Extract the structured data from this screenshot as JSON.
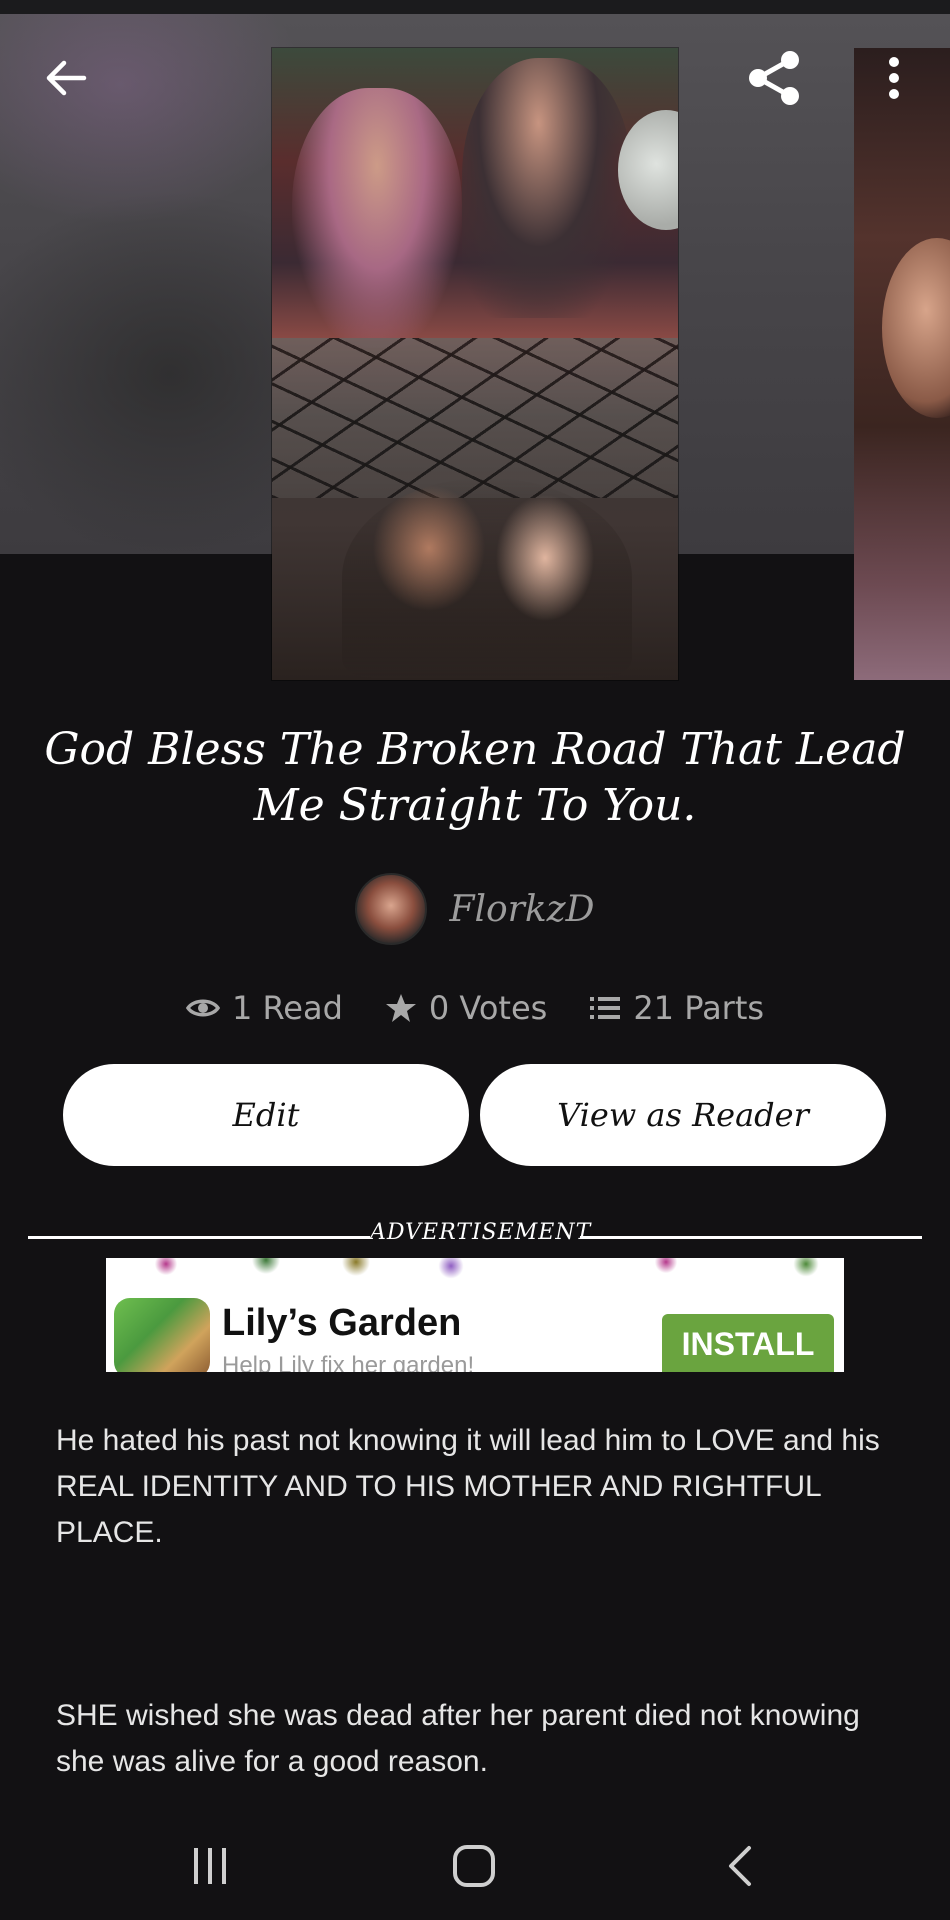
{
  "story": {
    "title": "God Bless The Broken Road That Lead Me Straight To You.",
    "author": "FlorkzD"
  },
  "stats": {
    "reads": "1 Read",
    "votes": "0 Votes",
    "parts": "21 Parts"
  },
  "actions": {
    "edit_label": "Edit",
    "view_as_reader_label": "View as Reader"
  },
  "advertisement": {
    "label": "ADVERTISEMENT",
    "app_name": "Lily’s Garden",
    "tagline": "Help Lily fix her garden!",
    "cta": "INSTALL",
    "cta_color": "#6aa43f"
  },
  "description": {
    "paragraph_1": "He hated his past not knowing it will lead him to LOVE and his REAL IDENTITY AND TO HIS MOTHER AND RIGHTFUL PLACE.",
    "paragraph_2": "SHE wished she was dead after her parent died not knowing she was alive for a good reason."
  },
  "icons": {
    "back": "back-arrow-icon",
    "share": "share-icon",
    "more": "more-vertical-icon",
    "reads": "eye-icon",
    "votes": "star-icon",
    "parts": "list-icon",
    "nav_recent": "recent-apps-icon",
    "nav_home": "home-icon",
    "nav_back": "chevron-left-icon"
  },
  "colors": {
    "background": "#121113",
    "stat_text": "#a8a8a8",
    "author_text": "#9c9c9c",
    "button_bg": "#ffffff"
  }
}
